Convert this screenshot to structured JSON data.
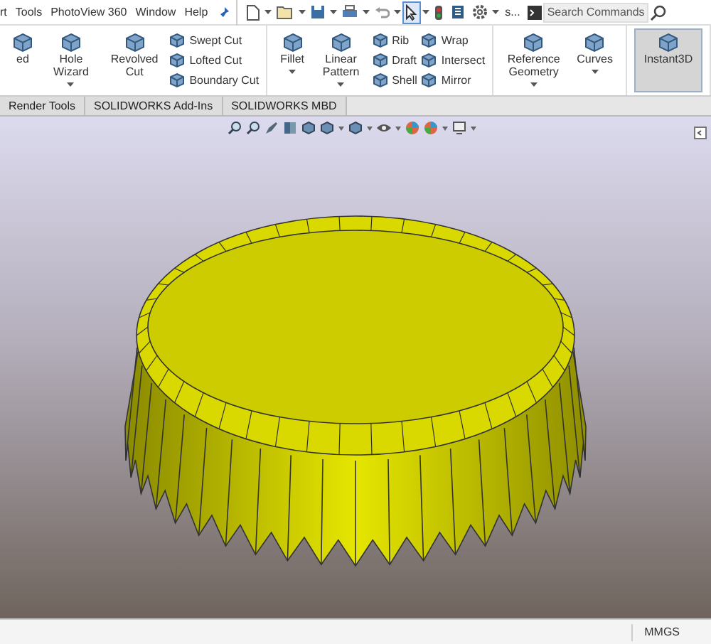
{
  "menu_bar": {
    "items": [
      "rt",
      "Tools",
      "PhotoView 360",
      "Window",
      "Help"
    ]
  },
  "quick_toolbar": {
    "tools": [
      {
        "kind": "new",
        "dropdown": true,
        "selected": false
      },
      {
        "kind": "open",
        "dropdown": true,
        "selected": false
      },
      {
        "kind": "save",
        "dropdown": true,
        "selected": false
      },
      {
        "kind": "print",
        "dropdown": true,
        "selected": false
      },
      {
        "kind": "undo",
        "dropdown": true,
        "selected": false
      },
      {
        "kind": "select",
        "dropdown": true,
        "selected": true
      },
      {
        "kind": "rebuild",
        "dropdown": false,
        "selected": false
      },
      {
        "kind": "properties",
        "dropdown": false,
        "selected": false
      },
      {
        "kind": "options",
        "dropdown": true,
        "selected": false
      }
    ],
    "overflow": "s...",
    "search": {
      "placeholder": "Search Commands"
    }
  },
  "ribbon": {
    "groups": [
      {
        "items": [
          {
            "kind": "large",
            "label": "ed",
            "dropdown": false,
            "selected": false
          },
          {
            "kind": "large",
            "label": "Hole Wizard",
            "dropdown": true,
            "selected": false
          },
          {
            "kind": "large",
            "label": "Revolved Cut",
            "dropdown": false,
            "selected": false
          },
          {
            "kind": "stack",
            "labels": [
              "Swept Cut",
              "Lofted Cut",
              "Boundary Cut"
            ]
          }
        ]
      },
      {
        "items": [
          {
            "kind": "large",
            "label": "Fillet",
            "dropdown": true,
            "selected": false
          },
          {
            "kind": "large",
            "label": "Linear Pattern",
            "dropdown": true,
            "selected": false
          },
          {
            "kind": "stack",
            "labels": [
              "Rib",
              "Draft",
              "Shell"
            ]
          },
          {
            "kind": "stack",
            "labels": [
              "Wrap",
              "Intersect",
              "Mirror"
            ]
          }
        ]
      },
      {
        "items": [
          {
            "kind": "large",
            "label": "Reference Geometry",
            "dropdown": true,
            "selected": false
          },
          {
            "kind": "large",
            "label": "Curves",
            "dropdown": true,
            "selected": false
          }
        ]
      },
      {
        "items": [
          {
            "kind": "large",
            "label": "Instant3D",
            "dropdown": false,
            "selected": true
          }
        ]
      }
    ]
  },
  "tabs": [
    {
      "label": "Render Tools",
      "selected": false
    },
    {
      "label": "SOLIDWORKS Add-Ins",
      "selected": false
    },
    {
      "label": "SOLIDWORKS MBD",
      "selected": false
    }
  ],
  "status_bar": {
    "units": "MMGS"
  }
}
